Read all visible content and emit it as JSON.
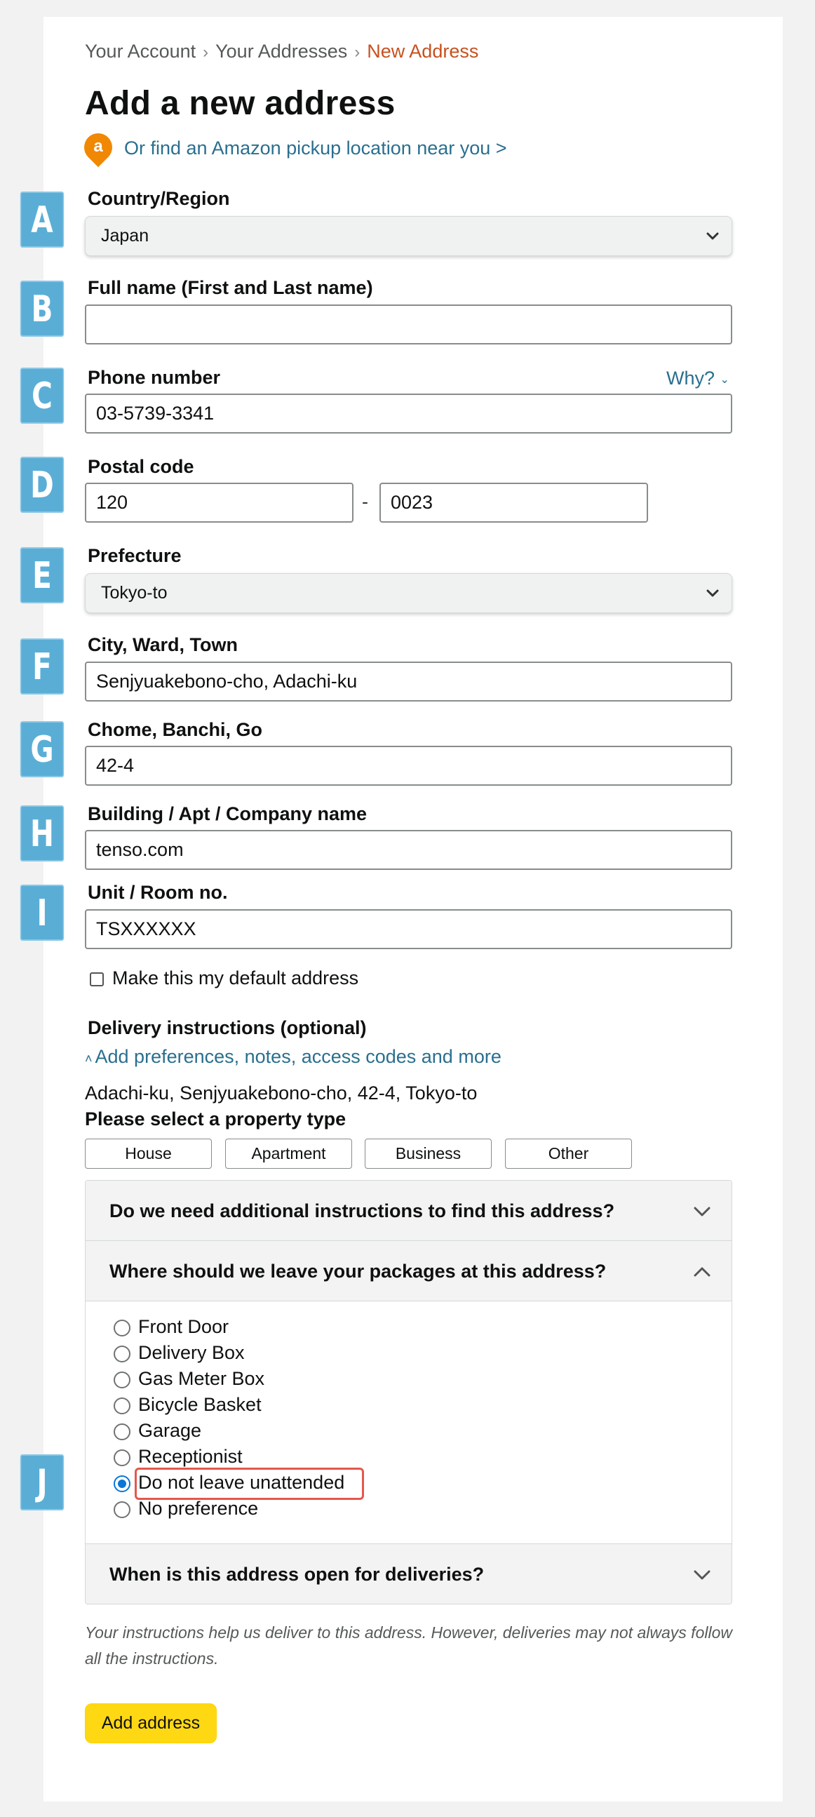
{
  "breadcrumb": {
    "items": [
      "Your Account",
      "Your Addresses"
    ],
    "current": "New Address",
    "separator": "›"
  },
  "page_title": "Add a new address",
  "pickup": {
    "icon_letter": "a",
    "link_text": "Or find an Amazon pickup location near you >"
  },
  "badges": [
    "A",
    "B",
    "C",
    "D",
    "E",
    "F",
    "G",
    "H",
    "I",
    "J"
  ],
  "fields": {
    "country": {
      "label": "Country/Region",
      "value": "Japan"
    },
    "full_name": {
      "label": "Full name (First and Last name)",
      "value": ""
    },
    "phone": {
      "label": "Phone number",
      "value": "03-5739-3341",
      "why_link": "Why?"
    },
    "postal": {
      "label": "Postal code",
      "part1": "120",
      "dash": "-",
      "part2": "0023"
    },
    "prefecture": {
      "label": "Prefecture",
      "value": "Tokyo-to"
    },
    "city": {
      "label": "City, Ward, Town",
      "value": "Senjyuakebono-cho, Adachi-ku"
    },
    "chome": {
      "label": "Chome, Banchi, Go",
      "value": "42-4"
    },
    "building": {
      "label": "Building / Apt / Company name",
      "value": "tenso.com"
    },
    "unit": {
      "label": "Unit / Room no.",
      "value": "TSXXXXXX"
    }
  },
  "default_address": {
    "label": "Make this my default address",
    "checked": false
  },
  "delivery": {
    "heading": "Delivery instructions (optional)",
    "prefs_link": "Add preferences, notes, access codes and more",
    "address_summary": "Adachi-ku, Senjyuakebono-cho, 42-4, Tokyo-to",
    "property_heading": "Please select a property type",
    "property_types": [
      "House",
      "Apartment",
      "Business",
      "Other"
    ],
    "sections": [
      {
        "title": "Do we need additional instructions to find this address?",
        "expanded": false
      },
      {
        "title": "Where should we leave your packages at this address?",
        "expanded": true
      },
      {
        "title": "When is this address open for deliveries?",
        "expanded": false
      }
    ],
    "leave_options": [
      "Front Door",
      "Delivery Box",
      "Gas Meter Box",
      "Bicycle Basket",
      "Garage",
      "Receptionist",
      "Do not leave unattended",
      "No preference"
    ],
    "selected_option": "Do not leave unattended",
    "disclaimer": "Your instructions help us deliver to this address. However, deliveries may not always follow all the instructions."
  },
  "submit_label": "Add address",
  "colors": {
    "link": "#2a6f8f",
    "breadcrumb_current": "#c7511f",
    "badge": "#5aaed6",
    "button": "#ffd814",
    "highlight": "#e4574d",
    "radio_selected": "#0a76d6",
    "pickup_icon": "#f08804"
  }
}
